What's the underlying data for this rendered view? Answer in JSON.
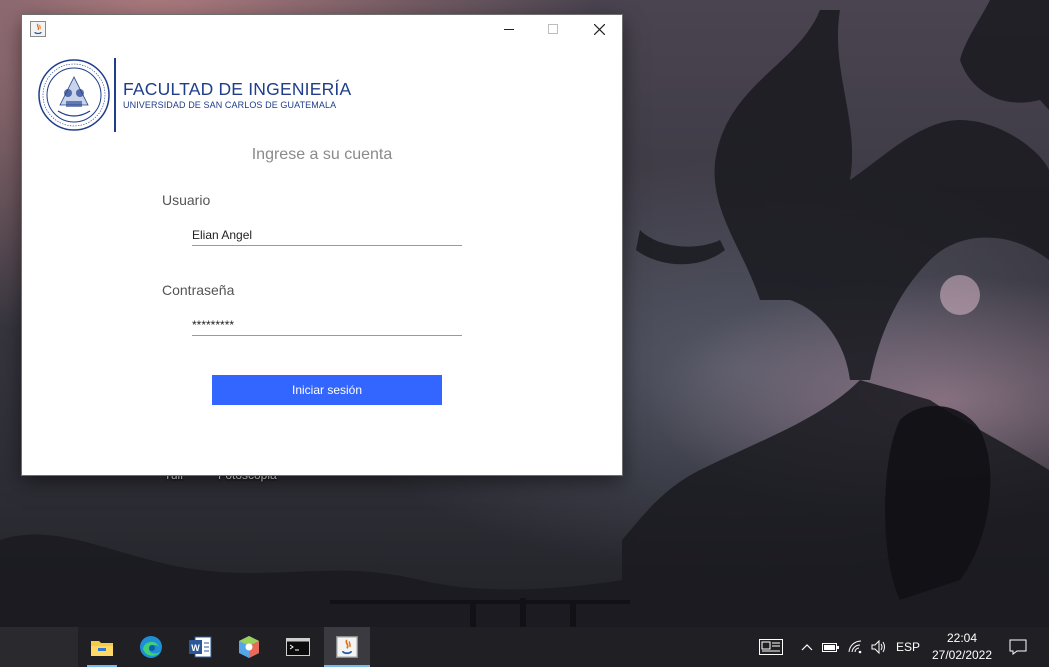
{
  "window": {
    "header": {
      "faculty_title": "FACULTAD DE INGENIERÍA",
      "university": "UNIVERSIDAD DE SAN CARLOS DE GUATEMALA",
      "seal_text": "ID Y ENSEÑAD A TODOS"
    },
    "heading": "Ingrese a su cuenta",
    "username": {
      "label": "Usuario",
      "value": "Elian Angel"
    },
    "password": {
      "label": "Contraseña",
      "value": "*********"
    },
    "login_button": "Iniciar sesión"
  },
  "desktop": {
    "labels": [
      "Tuli",
      "Fotoscopia"
    ]
  },
  "taskbar": {
    "apps": [
      "file-explorer-icon",
      "edge-icon",
      "word-icon",
      "3d-box-icon",
      "terminal-icon",
      "java-icon"
    ],
    "tray": {
      "language": "ESP",
      "time": "22:04",
      "date": "27/02/2022"
    }
  },
  "colors": {
    "accent": "#3366ff",
    "brand_blue": "#1f3d8a",
    "taskbar": "#202024"
  }
}
